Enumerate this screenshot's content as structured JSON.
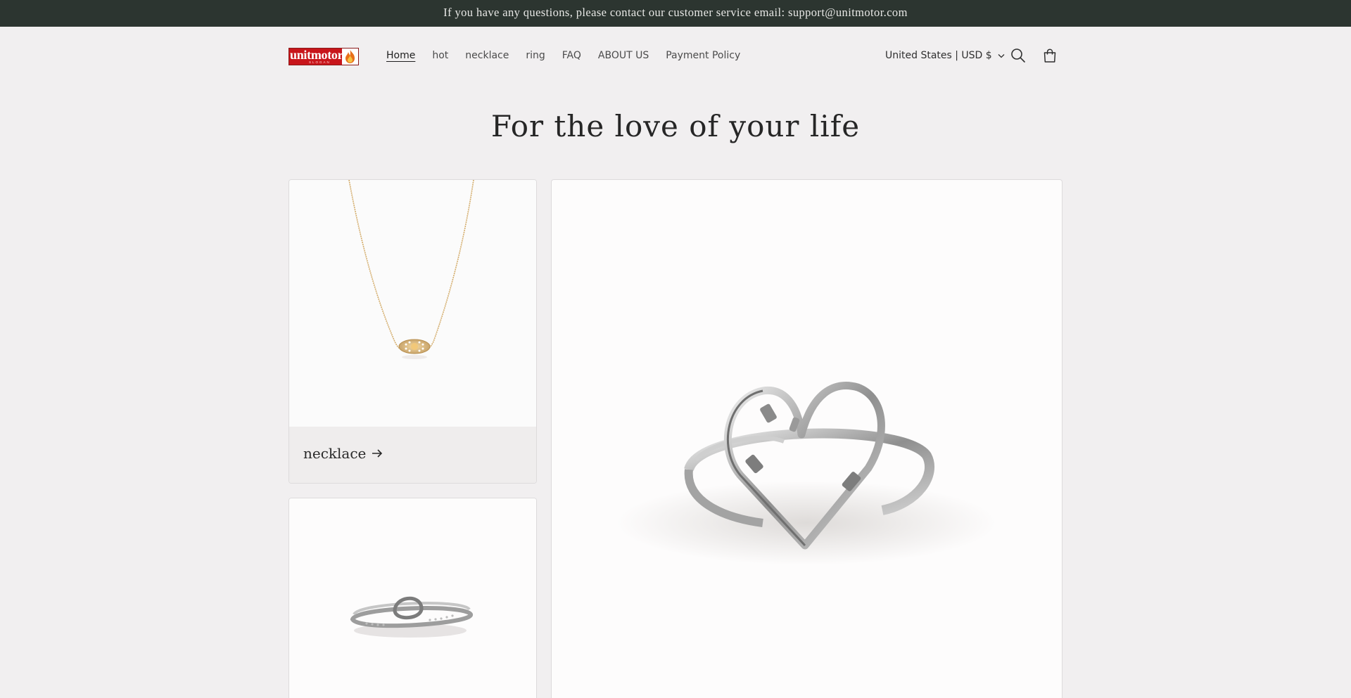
{
  "announcement": {
    "text": "If you have any questions, please contact our customer service email: support@unitmotor.com"
  },
  "header": {
    "logo": {
      "brand": "unitmotor",
      "slogan": "SLOGAN"
    },
    "nav": [
      {
        "label": "Home",
        "active": true
      },
      {
        "label": "hot"
      },
      {
        "label": "necklace"
      },
      {
        "label": "ring"
      },
      {
        "label": "FAQ"
      },
      {
        "label": "ABOUT US"
      },
      {
        "label": "Payment Policy"
      }
    ],
    "locale": "United States | USD $",
    "icons": {
      "search": "search-icon",
      "cart": "cart-icon",
      "chevron": "chevron-down-icon",
      "arrow": "arrow-right-icon"
    }
  },
  "main": {
    "title": "For the love of your life",
    "collections": [
      {
        "label": "necklace"
      }
    ]
  },
  "colors": {
    "announcement_bg": "#2c3530",
    "page_bg": "#f1eff0",
    "logo_red": "#c8151b"
  }
}
